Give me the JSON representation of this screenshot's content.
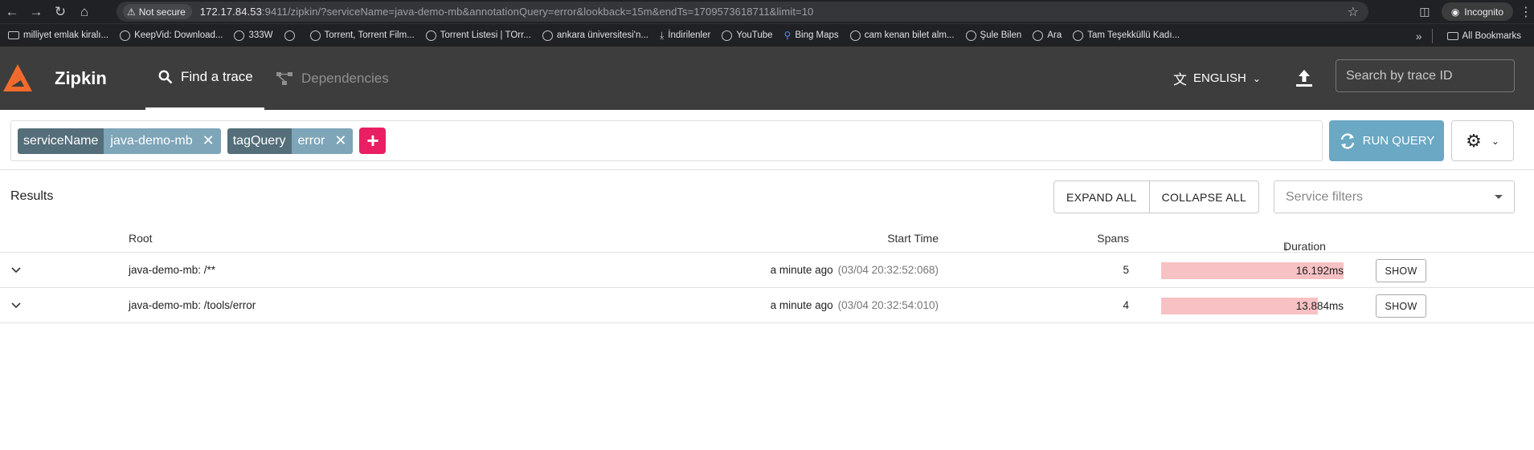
{
  "browser": {
    "security_label": "Not secure",
    "url_host": "172.17.84.53",
    "url_rest": ":9411/zipkin/?serviceName=java-demo-mb&annotationQuery=error&lookback=15m&endTs=1709573618711&limit=10",
    "incognito_label": "Incognito",
    "bookmarks": [
      {
        "label": "milliyet emlak kiralı...",
        "icon": "folder-icon"
      },
      {
        "label": "KeepVid: Download...",
        "icon": "globe-icon"
      },
      {
        "label": "333W",
        "icon": "globe-icon"
      },
      {
        "label": "",
        "icon": "globe-icon"
      },
      {
        "label": "Torrent, Torrent Film...",
        "icon": "globe-icon"
      },
      {
        "label": "Torrent Listesi | TOrr...",
        "icon": "globe-icon"
      },
      {
        "label": "ankara üniversitesi'n...",
        "icon": "globe-icon"
      },
      {
        "label": "İndirilenler",
        "icon": "download-icon"
      },
      {
        "label": "YouTube",
        "icon": "globe-icon"
      },
      {
        "label": "Bing Maps",
        "icon": "search-icon"
      },
      {
        "label": "cam kenan bilet alm...",
        "icon": "globe-icon"
      },
      {
        "label": "Şule Bilen",
        "icon": "globe-icon"
      },
      {
        "label": "Ara",
        "icon": "globe-icon"
      },
      {
        "label": "Tam Teşekküllü Kadı...",
        "icon": "globe-icon"
      }
    ],
    "all_bookmarks_label": "All Bookmarks"
  },
  "header": {
    "brand": "Zipkin",
    "tab_find": "Find a trace",
    "tab_dependencies": "Dependencies",
    "language": "ENGLISH",
    "search_placeholder": "Search by trace ID",
    "accent_color": "#f26b2c"
  },
  "query": {
    "chips": [
      {
        "key": "serviceName",
        "value": "java-demo-mb"
      },
      {
        "key": "tagQuery",
        "value": "error"
      }
    ],
    "run_label": "RUN QUERY"
  },
  "results": {
    "title": "Results",
    "expand_all": "EXPAND ALL",
    "collapse_all": "COLLAPSE ALL",
    "service_filter_placeholder": "Service filters",
    "columns": {
      "root": "Root",
      "start_time": "Start Time",
      "spans": "Spans",
      "duration": "Duration"
    },
    "rows": [
      {
        "root": "java-demo-mb: /**",
        "relative": "a minute ago",
        "absolute": "(03/04 20:32:52:068)",
        "spans": "5",
        "duration": "16.192ms",
        "duration_fraction": 1.0,
        "action": "SHOW"
      },
      {
        "root": "java-demo-mb: /tools/error",
        "relative": "a minute ago",
        "absolute": "(03/04 20:32:54:010)",
        "spans": "4",
        "duration": "13.884ms",
        "duration_fraction": 0.857,
        "action": "SHOW"
      }
    ]
  }
}
